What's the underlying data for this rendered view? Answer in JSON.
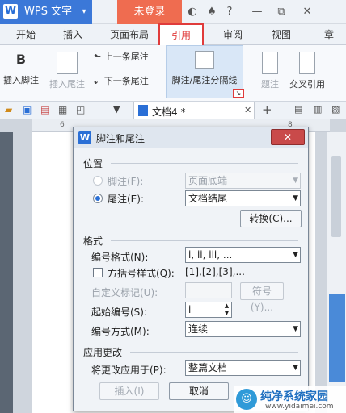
{
  "titlebar": {
    "app_title": "WPS 文字",
    "login_label": "未登录"
  },
  "tabs": [
    "开始",
    "插入",
    "页面布局",
    "引用",
    "审阅",
    "视图",
    "章"
  ],
  "ribbon": {
    "footnote_label": "插入脚注",
    "insert_endnote": "插入尾注",
    "prev_endnote": "上一条尾注",
    "next_endnote": "下一条尾注",
    "separator": "脚注/尾注分隔线",
    "caption": "题注",
    "cross_ref": "交叉引用"
  },
  "doc": {
    "tab_title": "文档4 *"
  },
  "dialog": {
    "title": "脚注和尾注",
    "section_position": "位置",
    "footnote_label": "脚注(F):",
    "footnote_value": "页面底端",
    "endnote_label": "尾注(E):",
    "endnote_value": "文档结尾",
    "convert_button": "转换(C)...",
    "section_format": "格式",
    "number_format_label": "编号格式(N):",
    "number_format_value": "i, ii, iii, ...",
    "bracket_label": "方括号样式(Q):",
    "bracket_value": "[1],[2],[3],...",
    "custom_mark_label": "自定义标记(U):",
    "symbol_button": "符号(Y)...",
    "start_number_label": "起始编号(S):",
    "start_number_value": "i",
    "numbering_label": "编号方式(M):",
    "numbering_value": "连续",
    "section_apply": "应用更改",
    "apply_to_label": "将更改应用于(P):",
    "apply_to_value": "整篇文档",
    "insert_button": "插入(I)",
    "cancel_button": "取消"
  },
  "watermark": {
    "name": "纯净系统家园",
    "url": "www.yidaimei.com"
  },
  "ruler": {
    "left_mark": "6",
    "right_mark": "8"
  }
}
